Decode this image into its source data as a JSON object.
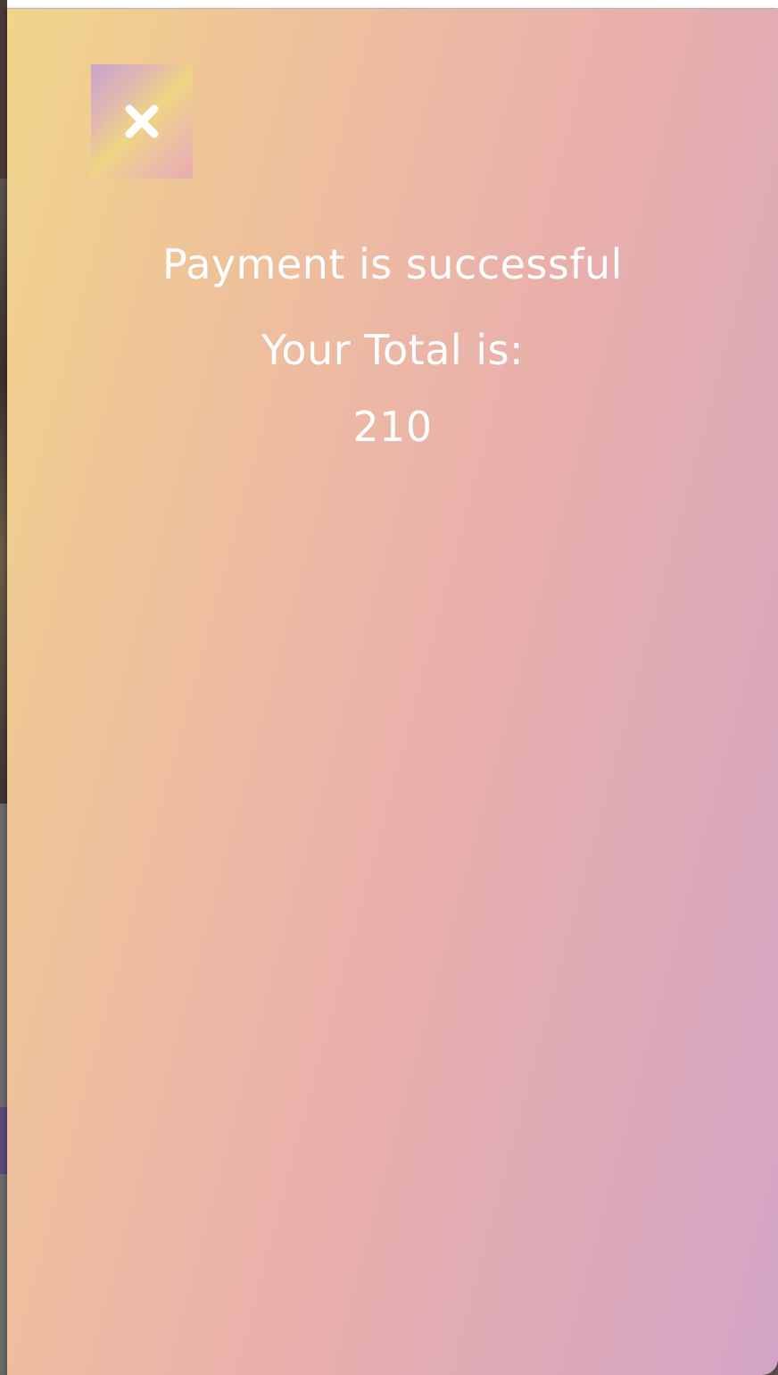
{
  "modal": {
    "close_icon": "close-icon",
    "success_message": "Payment is successful",
    "total_label": "Your Total is:",
    "total_value": "210"
  },
  "colors": {
    "text": "#ffffff",
    "gradient_start": "#f0d58a",
    "gradient_mid": "#e8aeac",
    "gradient_end": "#d3a4c6"
  }
}
